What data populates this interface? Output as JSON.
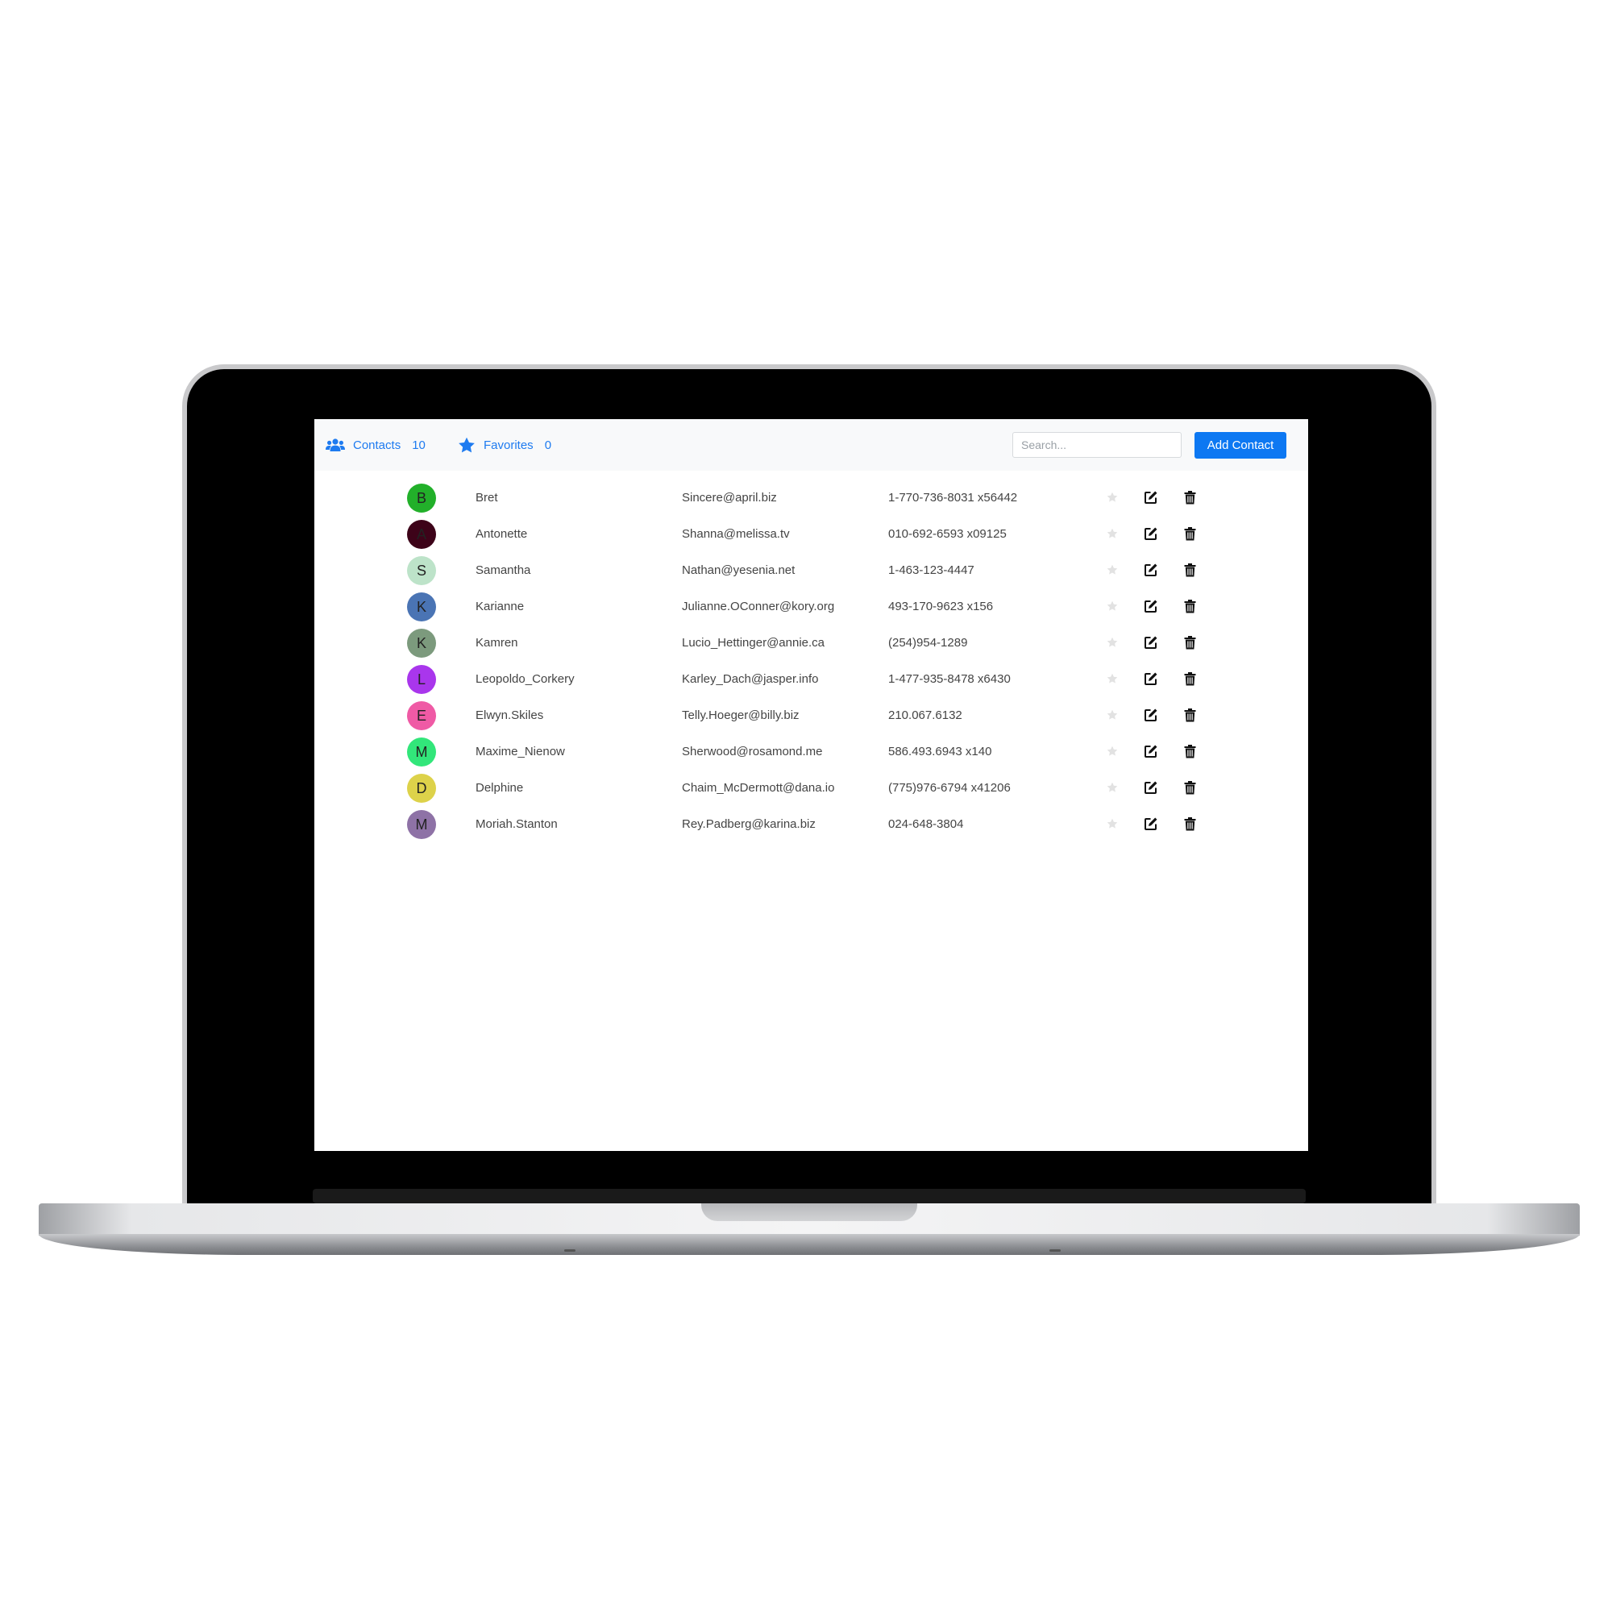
{
  "app": {
    "accent_color": "#1e7bf0",
    "button_color": "#0d78f2"
  },
  "nav": {
    "contacts": {
      "label": "Contacts",
      "count": "10",
      "icon": "users-icon"
    },
    "favorites": {
      "label": "Favorites",
      "count": "0",
      "icon": "star-icon"
    }
  },
  "search": {
    "placeholder": "Search...",
    "value": ""
  },
  "add_button": {
    "label": "Add Contact"
  },
  "contacts": [
    {
      "initial": "B",
      "avatar_color": "#22b02a",
      "name": "Bret",
      "email": "Sincere@april.biz",
      "phone": "1-770-736-8031 x56442",
      "favorite": false
    },
    {
      "initial": "A",
      "avatar_color": "#3d0319",
      "name": "Antonette",
      "email": "Shanna@melissa.tv",
      "phone": "010-692-6593 x09125",
      "favorite": false
    },
    {
      "initial": "S",
      "avatar_color": "#bde3c9",
      "name": "Samantha",
      "email": "Nathan@yesenia.net",
      "phone": "1-463-123-4447",
      "favorite": false
    },
    {
      "initial": "K",
      "avatar_color": "#4a74b4",
      "name": "Karianne",
      "email": "Julianne.OConner@kory.org",
      "phone": "493-170-9623 x156",
      "favorite": false
    },
    {
      "initial": "K",
      "avatar_color": "#7c9a7d",
      "name": "Kamren",
      "email": "Lucio_Hettinger@annie.ca",
      "phone": "(254)954-1289",
      "favorite": false
    },
    {
      "initial": "L",
      "avatar_color": "#a936ec",
      "name": "Leopoldo_Corkery",
      "email": "Karley_Dach@jasper.info",
      "phone": "1-477-935-8478 x6430",
      "favorite": false
    },
    {
      "initial": "E",
      "avatar_color": "#ef5aa5",
      "name": "Elwyn.Skiles",
      "email": "Telly.Hoeger@billy.biz",
      "phone": "210.067.6132",
      "favorite": false
    },
    {
      "initial": "M",
      "avatar_color": "#32e67a",
      "name": "Maxime_Nienow",
      "email": "Sherwood@rosamond.me",
      "phone": "586.493.6943 x140",
      "favorite": false
    },
    {
      "initial": "D",
      "avatar_color": "#ddd24a",
      "name": "Delphine",
      "email": "Chaim_McDermott@dana.io",
      "phone": "(775)976-6794 x41206",
      "favorite": false
    },
    {
      "initial": "M",
      "avatar_color": "#8e72a6",
      "name": "Moriah.Stanton",
      "email": "Rey.Padberg@karina.biz",
      "phone": "024-648-3804",
      "favorite": false
    }
  ],
  "row_actions": {
    "favorite_icon": "star-icon",
    "edit_icon": "edit-icon",
    "delete_icon": "trash-icon",
    "favorite_off_color": "#e2e2e2",
    "favorite_on_color": "#f5b800"
  }
}
